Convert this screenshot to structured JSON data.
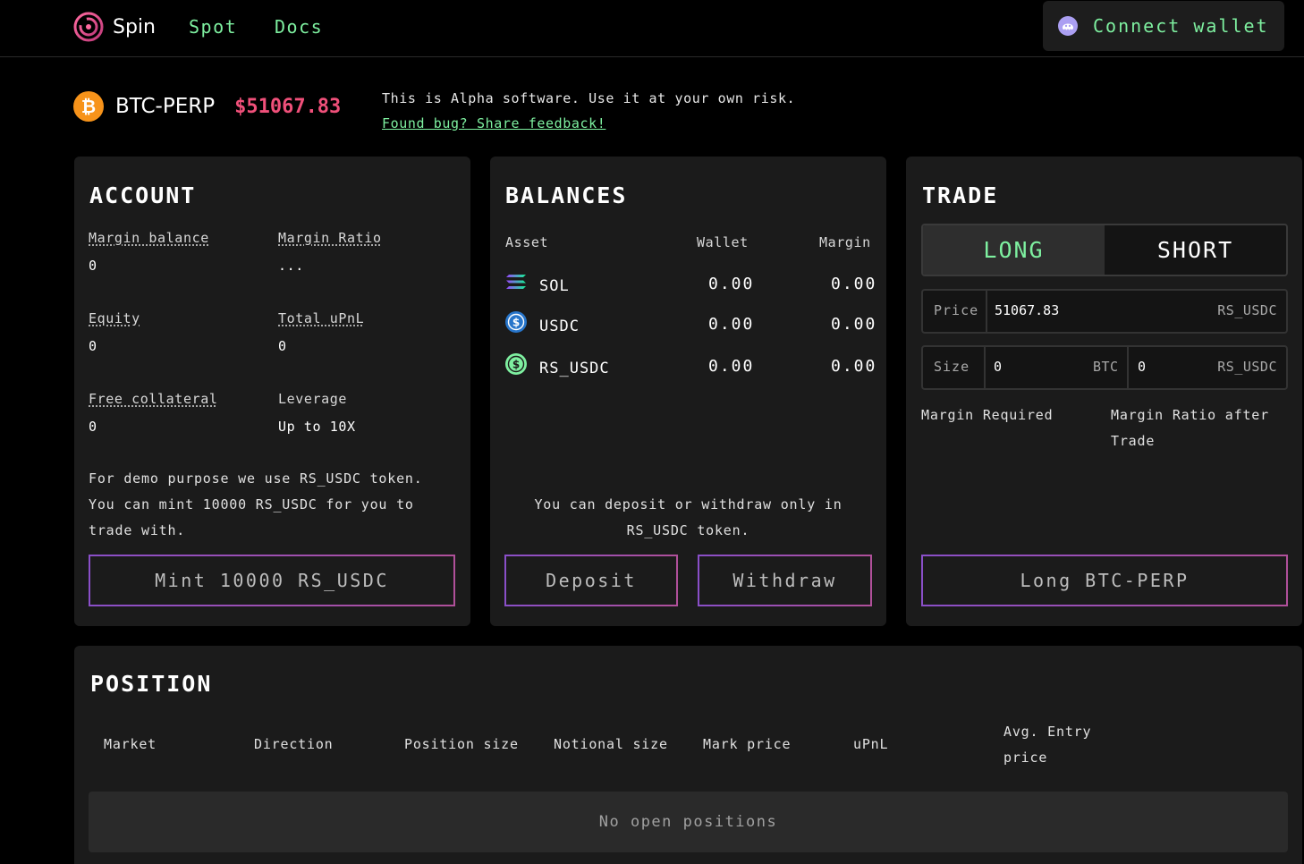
{
  "header": {
    "app_name": "Spin",
    "nav": [
      {
        "label": "Spot"
      },
      {
        "label": "Docs"
      }
    ],
    "connect_label": "Connect wallet",
    "accent": "#7ef0a0"
  },
  "market": {
    "name": "BTC-PERP",
    "price": "$51067.83",
    "alpha_notice": "This is Alpha software. Use it at your own risk.",
    "feedback_link": "Found bug? Share feedback!"
  },
  "account": {
    "title": "ACCOUNT",
    "margin_balance": {
      "label": "Margin balance",
      "value": "0"
    },
    "margin_ratio": {
      "label": "Margin Ratio",
      "value": "..."
    },
    "equity": {
      "label": "Equity",
      "value": "0"
    },
    "total_upnl": {
      "label": "Total uPnL",
      "value": "0"
    },
    "free_collateral": {
      "label": "Free collateral",
      "value": "0"
    },
    "leverage": {
      "label": "Leverage",
      "value": "Up to 10X"
    },
    "note": "For demo purpose we use RS_USDC token. You can mint 10000 RS_USDC for you to trade with.",
    "mint_button": "Mint 10000 RS_USDC"
  },
  "balances": {
    "title": "BALANCES",
    "columns": {
      "asset": "Asset",
      "wallet": "Wallet",
      "margin": "Margin"
    },
    "rows": [
      {
        "asset": "SOL",
        "wallet": "0.00",
        "margin": "0.00",
        "icon": "sol-icon"
      },
      {
        "asset": "USDC",
        "wallet": "0.00",
        "margin": "0.00",
        "icon": "usdc-icon"
      },
      {
        "asset": "RS_USDC",
        "wallet": "0.00",
        "margin": "0.00",
        "icon": "rs-usdc-icon"
      }
    ],
    "note_line1": "You can deposit or withdraw only in",
    "note_line2": "RS_USDC token.",
    "deposit_button": "Deposit",
    "withdraw_button": "Withdraw"
  },
  "trade": {
    "title": "TRADE",
    "long_label": "LONG",
    "short_label": "SHORT",
    "price_label": "Price",
    "price_value": "51067.83",
    "price_unit": "RS_USDC",
    "size_label": "Size",
    "size_btc_value": "0",
    "size_btc_unit": "BTC",
    "size_usdc_value": "0",
    "size_usdc_unit": "RS_USDC",
    "margin_required_label": "Margin Required",
    "margin_ratio_after_label_line1": "Margin Ratio after",
    "margin_ratio_after_label_line2": "Trade",
    "submit_button": "Long BTC-PERP"
  },
  "position": {
    "title": "POSITION",
    "columns": [
      "Market",
      "Direction",
      "Position size",
      "Notional size",
      "Mark price",
      "uPnL"
    ],
    "avg_entry_line1": "Avg. Entry",
    "avg_entry_line2": "price",
    "empty_text": "No open positions"
  },
  "colors": {
    "price_red": "#f0507a",
    "green": "#7ef0a0",
    "card_bg": "#1b1b1b",
    "button_border_start": "#8a4fc8",
    "button_border_end": "#b0509a"
  }
}
